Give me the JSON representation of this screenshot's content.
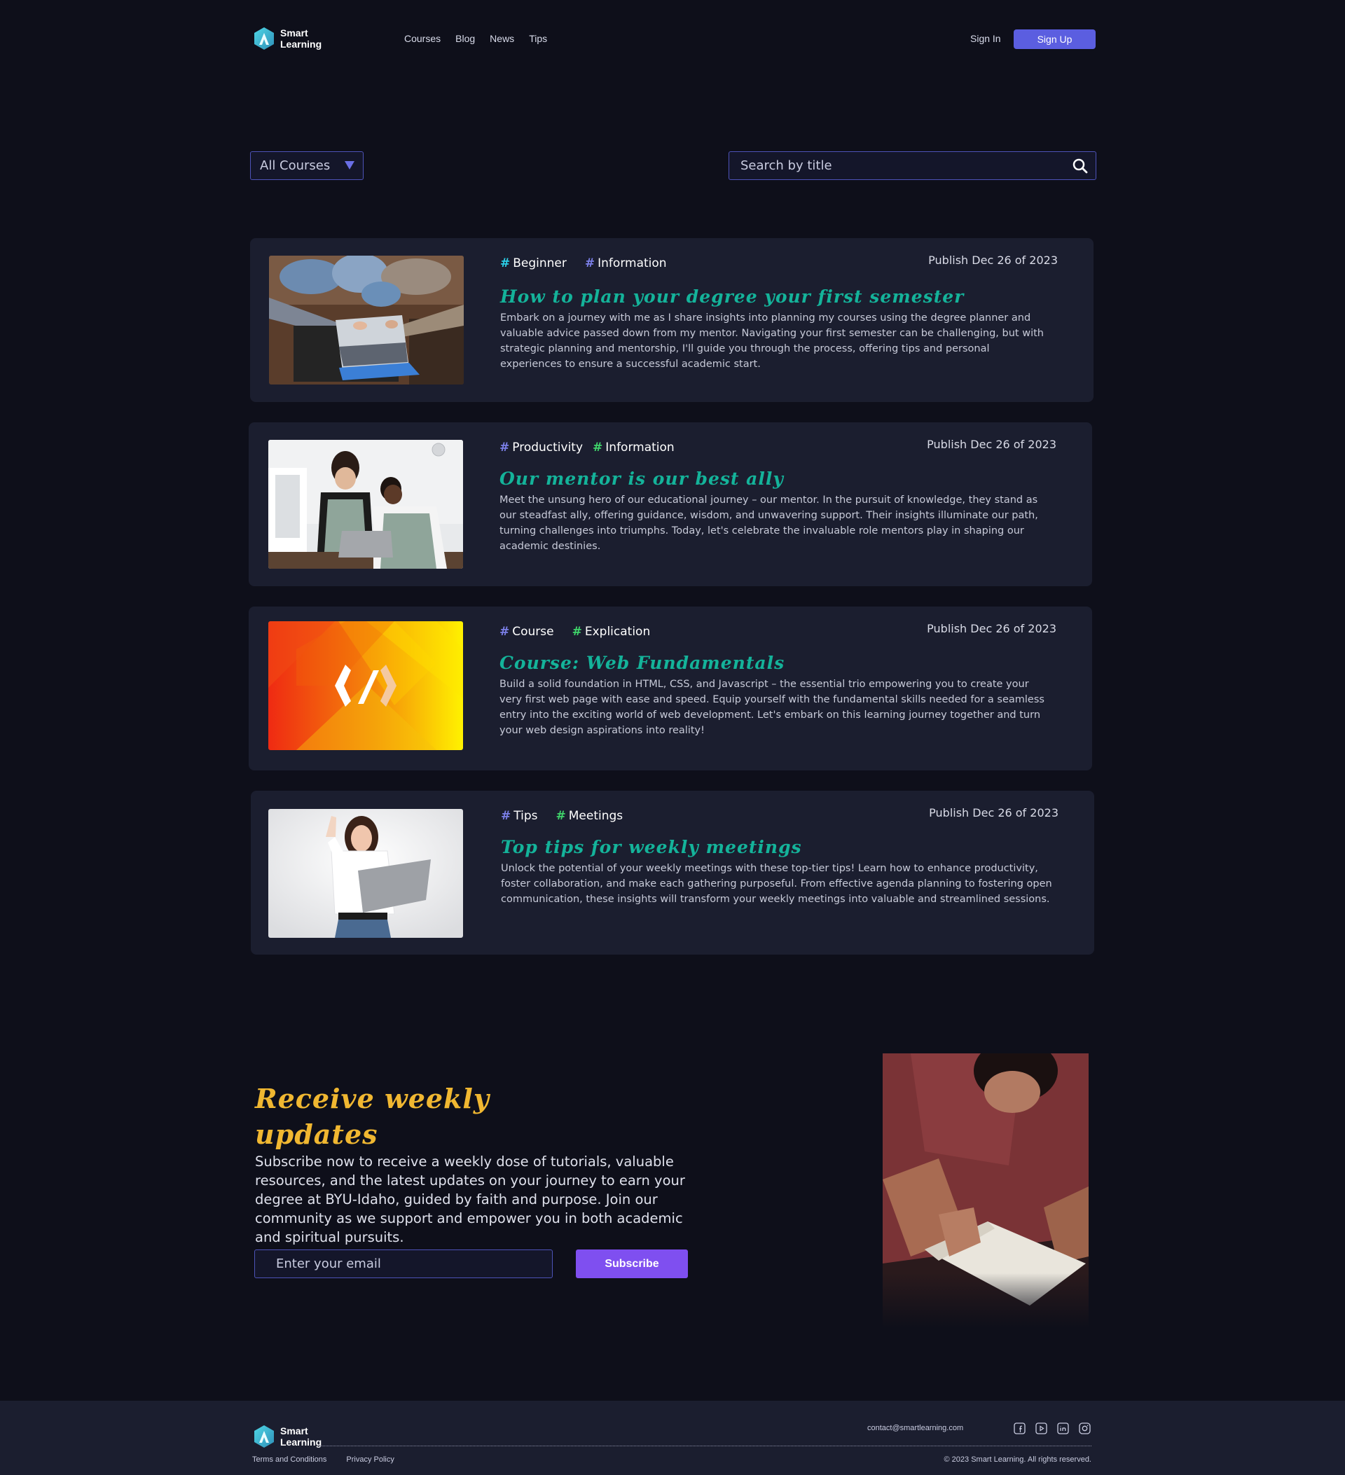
{
  "brand": {
    "name_line1": "Smart",
    "name_line2": "Learning",
    "colors": {
      "accent": "#5b5ee0",
      "title_teal": "#14b39a",
      "newsletter_gold": "#f0b731",
      "subscribe_purple": "#7f4ff0",
      "background": "#0e0f1a",
      "card": "#1b1e2f"
    }
  },
  "nav": {
    "items": [
      "Courses",
      "Blog",
      "News",
      "Tips"
    ],
    "sign_in": "Sign In",
    "sign_up": "Sign Up"
  },
  "filters": {
    "category_selected": "All Courses",
    "search_placeholder": "Search by title",
    "search_icon": "search-icon"
  },
  "posts": [
    {
      "tags": [
        {
          "label": "Beginner",
          "hash_color": "#2bd0e8"
        },
        {
          "label": "Information",
          "hash_color": "#7b7fe8"
        }
      ],
      "date": "Publish Dec 26 of 2023",
      "title": "How to plan your degree your first semester",
      "description": "Embark on a journey with me as I share insights into planning my courses using the degree planner and valuable advice passed down from my mentor. Navigating your first semester can be challenging, but with strategic planning and mentorship, I'll guide you through the process, offering tips and personal experiences to ensure a successful academic start."
    },
    {
      "tags": [
        {
          "label": "Productivity",
          "hash_color": "#7b7fe8"
        },
        {
          "label": "Information",
          "hash_color": "#3fd46a"
        }
      ],
      "date": "Publish Dec 26 of 2023",
      "title": "Our mentor is our best ally",
      "description": "Meet the unsung hero of our educational journey – our mentor. In the pursuit of knowledge, they stand as our steadfast ally, offering guidance, wisdom, and unwavering support. Their insights illuminate our path, turning challenges into triumphs. Today, let's celebrate the invaluable role mentors play in shaping our academic destinies."
    },
    {
      "tags": [
        {
          "label": "Course",
          "hash_color": "#7b7fe8"
        },
        {
          "label": "Explication",
          "hash_color": "#3fd46a"
        }
      ],
      "date": "Publish Dec 26 of 2023",
      "title": "Course: Web Fundamentals",
      "description": "Build a solid foundation in HTML, CSS, and Javascript – the essential trio empowering you to create your very first web page with ease and speed. Equip yourself with the fundamental skills needed for a seamless entry into the exciting world of web development. Let's embark on this learning journey together and turn your web design aspirations into reality!"
    },
    {
      "tags": [
        {
          "label": "Tips",
          "hash_color": "#7b7fe8"
        },
        {
          "label": "Meetings",
          "hash_color": "#3fd46a"
        }
      ],
      "date": "Publish Dec 26 of 2023",
      "title": "Top tips for weekly meetings",
      "description": "Unlock the potential of your weekly meetings with these top-tier tips! Learn how to enhance productivity, foster collaboration, and make each gathering purposeful. From effective agenda planning to fostering open communication, these insights will transform your weekly meetings into valuable and streamlined sessions."
    }
  ],
  "newsletter": {
    "title": "Receive weekly updates",
    "description": "Subscribe now to receive a weekly dose of tutorials, valuable resources, and the latest updates on your journey to earn your degree at BYU-Idaho, guided by faith and purpose. Join our community as we support and empower you in both academic and spiritual pursuits.",
    "email_placeholder": "Enter your email",
    "button": "Subscribe"
  },
  "footer": {
    "contact": "contact@smartlearning.com",
    "social_icons": [
      "facebook-icon",
      "youtube-icon",
      "linkedin-icon",
      "instagram-icon"
    ],
    "links": [
      "Terms and Conditions",
      "Privacy Policy"
    ],
    "copyright": "© 2023 Smart Learning. All rights reserved."
  }
}
